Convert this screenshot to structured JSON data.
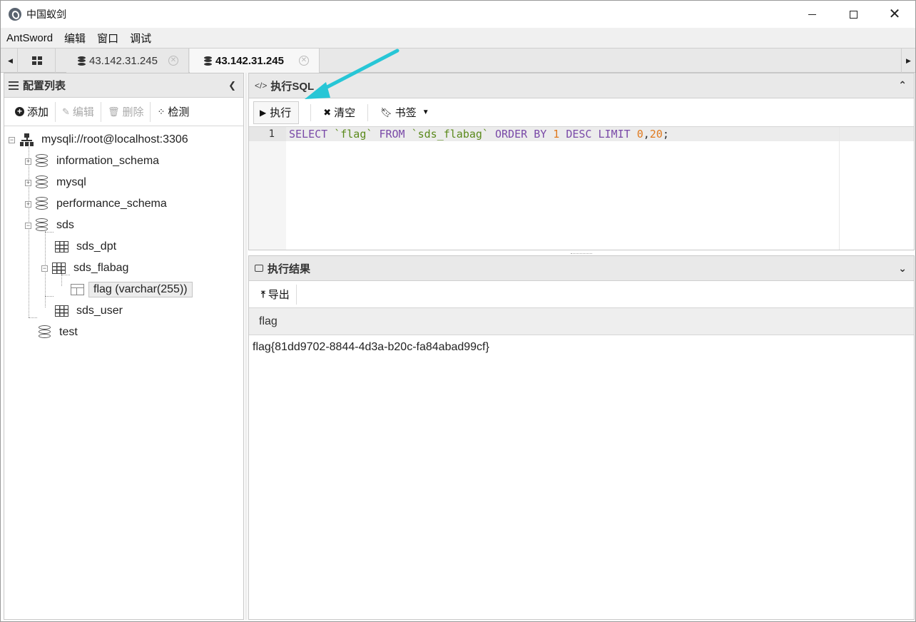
{
  "window": {
    "title": "中国蚁剑",
    "minimize_icon": "minimize-icon",
    "maximize_icon": "maximize-icon",
    "close_icon": "close-icon"
  },
  "menu": [
    "AntSword",
    "编辑",
    "窗口",
    "调试"
  ],
  "tabs": [
    {
      "label": "43.142.31.245",
      "active": false
    },
    {
      "label": "43.142.31.245",
      "active": true
    }
  ],
  "left_panel": {
    "title": "配置列表",
    "toolbar": {
      "add": "添加",
      "edit": "编辑",
      "delete": "删除",
      "detect": "检测"
    },
    "tree": {
      "connection": "mysqli://root@localhost:3306",
      "databases": [
        {
          "name": "information_schema",
          "expander": "+"
        },
        {
          "name": "mysql",
          "expander": "+"
        },
        {
          "name": "performance_schema",
          "expander": "+"
        },
        {
          "name": "sds",
          "expander": "−"
        },
        {
          "name": "test"
        }
      ],
      "tables": [
        {
          "name": "sds_dpt"
        },
        {
          "name": "sds_flabag",
          "expander": "−"
        },
        {
          "name": "sds_user"
        }
      ],
      "column": "flag (varchar(255))"
    }
  },
  "sql_panel": {
    "title": "执行SQL",
    "toolbar": {
      "execute": "执行",
      "clear": "清空",
      "bookmark": "书签"
    },
    "editor": {
      "line_number": "1",
      "tokens": {
        "select": "SELECT",
        "col": "`flag`",
        "from": "FROM",
        "table": "`sds_flabag`",
        "order": "ORDER",
        "by": "BY",
        "one": "1",
        "desc": "DESC",
        "limit": "LIMIT",
        "zero": "0",
        "comma": ",",
        "twenty": "20",
        "semi": ";"
      }
    }
  },
  "result_panel": {
    "title": "执行结果",
    "toolbar": {
      "export": "导出"
    },
    "columns": [
      "flag"
    ],
    "rows": [
      [
        "flag{81dd9702-8844-4d3a-b20c-fa84abad99cf}"
      ]
    ]
  },
  "colors": {
    "keyword": "#7a4aa8",
    "string": "#5b8a1c",
    "number": "#e07a1f",
    "annotation_arrow": "#27c6d6"
  }
}
